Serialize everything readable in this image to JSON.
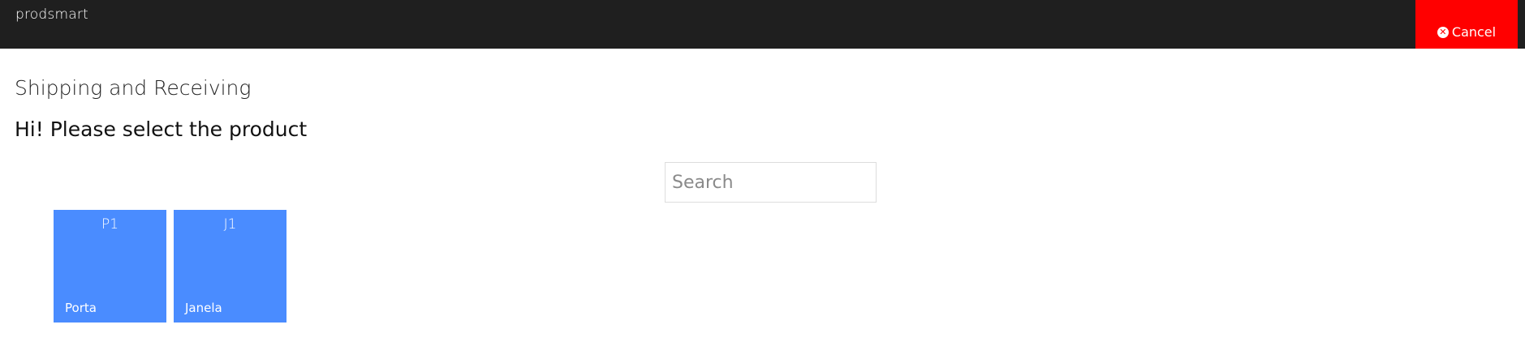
{
  "header": {
    "brand": "prodsmart",
    "cancel_label": "Cancel",
    "cancel_icon": "times-circle-icon",
    "background": "#1f1f1f",
    "cancel_color": "#ff0000"
  },
  "page": {
    "section_title": "Shipping and Receiving",
    "prompt": "Hi! Please select the product"
  },
  "search": {
    "placeholder": "Search",
    "value": ""
  },
  "products": [
    {
      "code": "P1",
      "name": "Porta"
    },
    {
      "code": "J1",
      "name": "Janela"
    }
  ],
  "colors": {
    "tile": "#4a8cff"
  }
}
